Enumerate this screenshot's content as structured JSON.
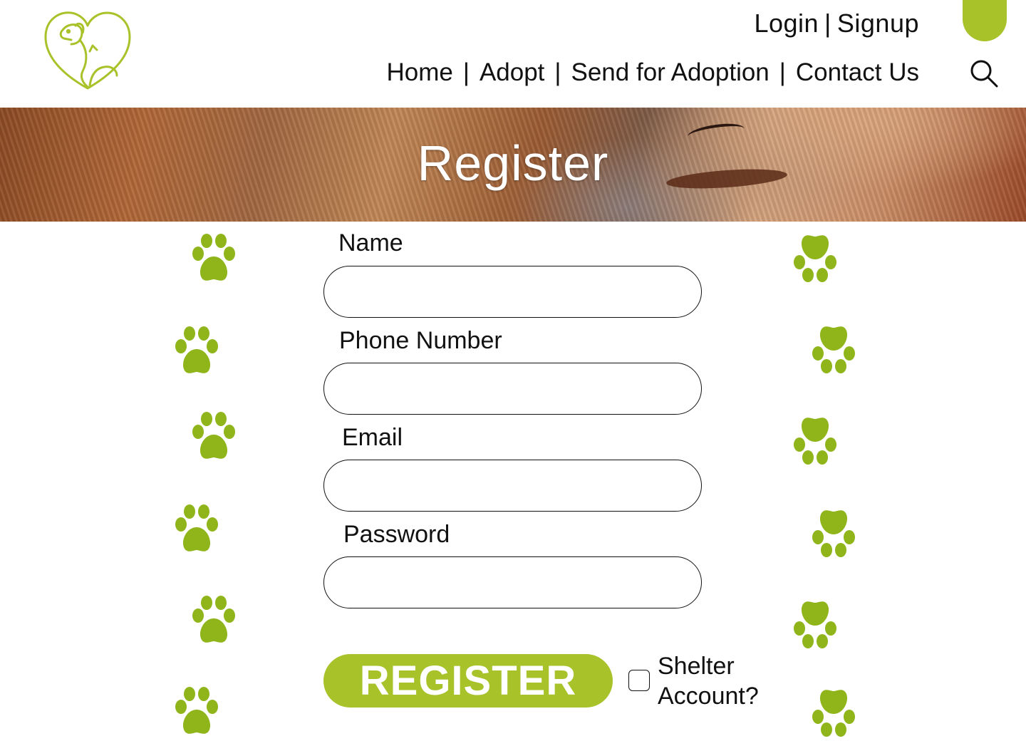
{
  "header": {
    "auth": {
      "login": "Login",
      "separator": "|",
      "signup": "Signup"
    },
    "nav": [
      {
        "label": "Home"
      },
      {
        "label": "Adopt"
      },
      {
        "label": "Send for Adoption"
      },
      {
        "label": "Contact Us"
      }
    ],
    "nav_separator": "|"
  },
  "hero": {
    "title": "Register"
  },
  "form": {
    "name_label": "Name",
    "phone_label": "Phone Number",
    "email_label": "Email",
    "password_label": "Password",
    "name_value": "",
    "phone_value": "",
    "email_value": "",
    "password_value": "",
    "register_label": "REGISTER",
    "shelter_label_line1": "Shelter",
    "shelter_label_line2": "Account?",
    "shelter_checked": false
  },
  "theme": {
    "accent": "#a8c22a",
    "text": "#111111",
    "background": "#ffffff"
  },
  "icons": {
    "logo": "dog-cat-heart-logo",
    "search": "search-icon",
    "decoration": "paw-print-icon"
  }
}
